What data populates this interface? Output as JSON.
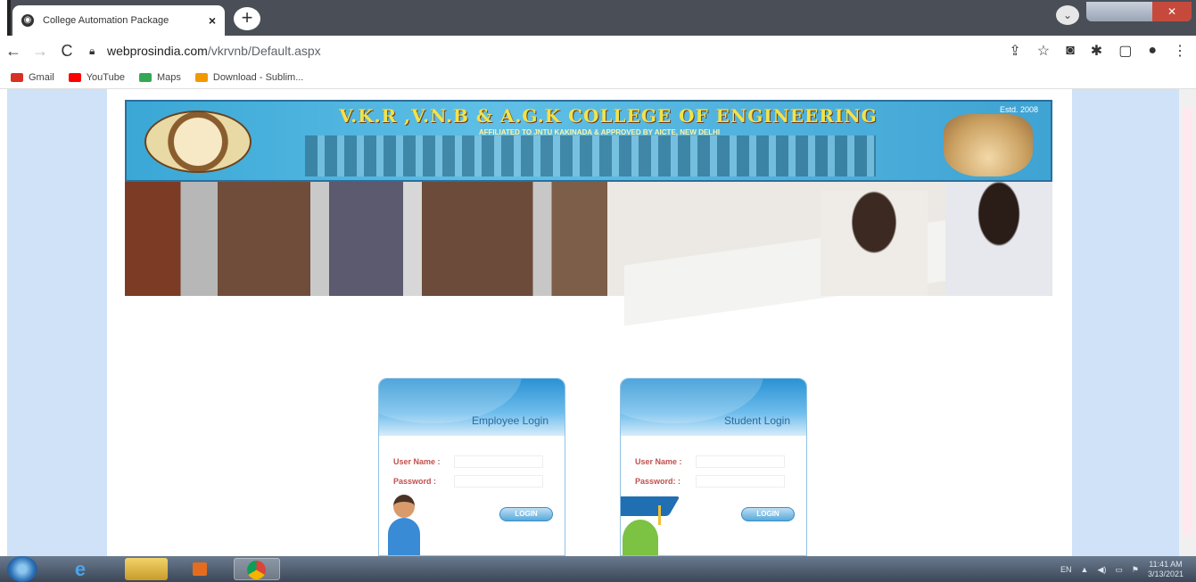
{
  "browser": {
    "tab_title": "College Automation Package",
    "tab_close": "×",
    "new_tab": "+",
    "url_host": "webprosindia.com",
    "url_path": "/vkrvnb/Default.aspx",
    "nav": {
      "back": "←",
      "forward": "→",
      "reload": "C"
    },
    "bookmarks": [
      {
        "label": "Gmail",
        "color": "#d93025"
      },
      {
        "label": "YouTube",
        "color": "#ff0000"
      },
      {
        "label": "Maps",
        "color": "#34a853"
      },
      {
        "label": "Download - Sublim...",
        "color": "#f29900"
      }
    ]
  },
  "banner": {
    "college_name": "V.K.R ,V.N.B & A.G.K COLLEGE OF ENGINEERING",
    "affiliation": "AFFILIATED TO JNTU KAKINADA & APPROVED BY AICTE, NEW DELHI",
    "estd": "Estd. 2008"
  },
  "employee_login": {
    "title": "Employee Login",
    "username_label": "User Name :",
    "password_label": "Password :",
    "button": "LOGIN"
  },
  "student_login": {
    "title": "Student Login",
    "username_label": "User Name :",
    "password_label": "Password: :",
    "button": "LOGIN"
  },
  "taskbar": {
    "lang": "EN",
    "time": "11:41 AM",
    "date": "3/13/2021"
  }
}
